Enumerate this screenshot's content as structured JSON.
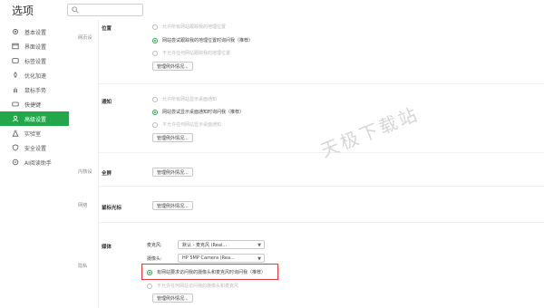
{
  "app": {
    "title": "选项"
  },
  "search": {
    "placeholder": ""
  },
  "sidebar": {
    "items": [
      {
        "label": "基本设置",
        "icon": "gear-icon"
      },
      {
        "label": "界面设置",
        "icon": "window-icon"
      },
      {
        "label": "标签设置",
        "icon": "tag-icon"
      },
      {
        "label": "优化加速",
        "icon": "rocket-icon"
      },
      {
        "label": "鼠标手势",
        "icon": "hand-icon"
      },
      {
        "label": "快捷键",
        "icon": "keyboard-icon"
      },
      {
        "label": "高级设置",
        "icon": "user-icon",
        "active": true
      },
      {
        "label": "实验室",
        "icon": "flask-icon"
      },
      {
        "label": "安全设置",
        "icon": "shield-icon"
      },
      {
        "label": "AI阅读助手",
        "icon": "ai-icon"
      }
    ]
  },
  "sections": {
    "page_content": "网页设",
    "internal": "内核设",
    "network": "网络",
    "privacy": "隐私"
  },
  "location": {
    "title": "位置",
    "options": [
      "允许所有网站跟踪我的地理位置",
      "网站尝试跟踪我的地理位置时询问我（推荐）",
      "不允许任何网站跟踪我的地理位置"
    ],
    "selected": 1,
    "manage_label": "管理例外情况..."
  },
  "notify": {
    "title": "通知",
    "options": [
      "允许所有网站显示桌面通知",
      "网站尝试显示桌面通知时询问我（推荐）",
      "不允许任何网站显示桌面通知"
    ],
    "selected": 1,
    "manage_label": "管理例外情况..."
  },
  "fullscreen": {
    "title": "全屏",
    "manage_label": "管理例外情况..."
  },
  "cursor": {
    "title": "鼠标光标",
    "manage_label": "管理例外情况..."
  },
  "media": {
    "title": "媒体",
    "mic_label": "麦克风:",
    "mic_value": "默认 - 麦克风 (Real...",
    "cam_label": "摄像头:",
    "cam_value": "HP 5MP Camera (Rea...",
    "options": [
      "有网站要求访问我的摄像头和麦克风时询问我（推荐）",
      "不允许任何网站访问我的摄像头和麦克风"
    ],
    "selected": 0,
    "manage_label": "管理例外情况..."
  },
  "watermark": "天极下载站",
  "colors": {
    "accent": "#22a84a",
    "highlight": "#e53935"
  }
}
